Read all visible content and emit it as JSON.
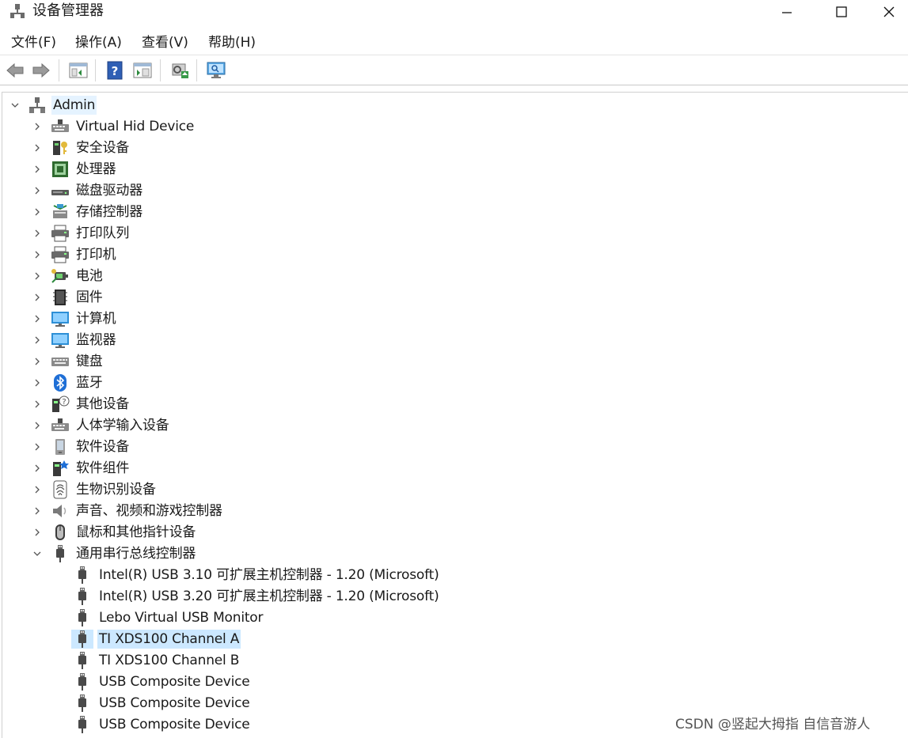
{
  "window": {
    "title": "设备管理器",
    "controls": {
      "minimize": "—",
      "maximize": "☐",
      "close": "✕"
    }
  },
  "menu": [
    {
      "label": "文件(F)"
    },
    {
      "label": "操作(A)"
    },
    {
      "label": "查看(V)"
    },
    {
      "label": "帮助(H)"
    }
  ],
  "toolbar": {
    "buttons": [
      {
        "icon": "back-arrow-icon"
      },
      {
        "icon": "forward-arrow-icon"
      },
      {
        "icon": "show-hide-console-tree-icon"
      },
      {
        "icon": "help-icon"
      },
      {
        "icon": "properties-pane-icon"
      },
      {
        "icon": "update-driver-icon"
      },
      {
        "icon": "scan-hardware-changes-icon"
      }
    ]
  },
  "tree": {
    "root": {
      "label": "Admin",
      "icon": "computer-network-icon",
      "expanded": true
    },
    "categories": [
      {
        "label": "Virtual Hid Device",
        "icon": "hid-keyboard-icon"
      },
      {
        "label": "安全设备",
        "icon": "security-device-icon"
      },
      {
        "label": "处理器",
        "icon": "processor-icon"
      },
      {
        "label": "磁盘驱动器",
        "icon": "disk-drive-icon"
      },
      {
        "label": "存储控制器",
        "icon": "storage-controller-icon"
      },
      {
        "label": "打印队列",
        "icon": "print-queue-icon"
      },
      {
        "label": "打印机",
        "icon": "printer-icon"
      },
      {
        "label": "电池",
        "icon": "battery-icon"
      },
      {
        "label": "固件",
        "icon": "firmware-icon"
      },
      {
        "label": "计算机",
        "icon": "computer-icon"
      },
      {
        "label": "监视器",
        "icon": "monitor-icon"
      },
      {
        "label": "键盘",
        "icon": "keyboard-icon"
      },
      {
        "label": "蓝牙",
        "icon": "bluetooth-icon"
      },
      {
        "label": "其他设备",
        "icon": "other-devices-icon"
      },
      {
        "label": "人体学输入设备",
        "icon": "human-interface-device-icon"
      },
      {
        "label": "软件设备",
        "icon": "software-device-icon"
      },
      {
        "label": "软件组件",
        "icon": "software-component-icon"
      },
      {
        "label": "生物识别设备",
        "icon": "biometric-fingerprint-icon"
      },
      {
        "label": "声音、视频和游戏控制器",
        "icon": "speaker-icon"
      },
      {
        "label": "鼠标和其他指针设备",
        "icon": "mouse-icon"
      },
      {
        "label": "通用串行总线控制器",
        "icon": "usb-plug-icon",
        "expanded": true,
        "children": [
          {
            "label": "Intel(R) USB 3.10 可扩展主机控制器 - 1.20 (Microsoft)",
            "icon": "usb-plug-icon"
          },
          {
            "label": "Intel(R) USB 3.20 可扩展主机控制器 - 1.20 (Microsoft)",
            "icon": "usb-plug-icon"
          },
          {
            "label": "Lebo Virtual USB Monitor",
            "icon": "usb-plug-icon"
          },
          {
            "label": "TI XDS100 Channel A",
            "icon": "usb-plug-icon",
            "selected": true
          },
          {
            "label": "TI XDS100 Channel B",
            "icon": "usb-plug-icon"
          },
          {
            "label": "USB Composite Device",
            "icon": "usb-plug-icon"
          },
          {
            "label": "USB Composite Device",
            "icon": "usb-plug-icon"
          },
          {
            "label": "USB Composite Device",
            "icon": "usb-plug-icon"
          }
        ]
      }
    ]
  },
  "watermark": "CSDN @竖起大拇指 自信音游人",
  "colors": {
    "selection": "#cce8ff",
    "chevron": "#555555",
    "usb_gray": "#555555"
  }
}
